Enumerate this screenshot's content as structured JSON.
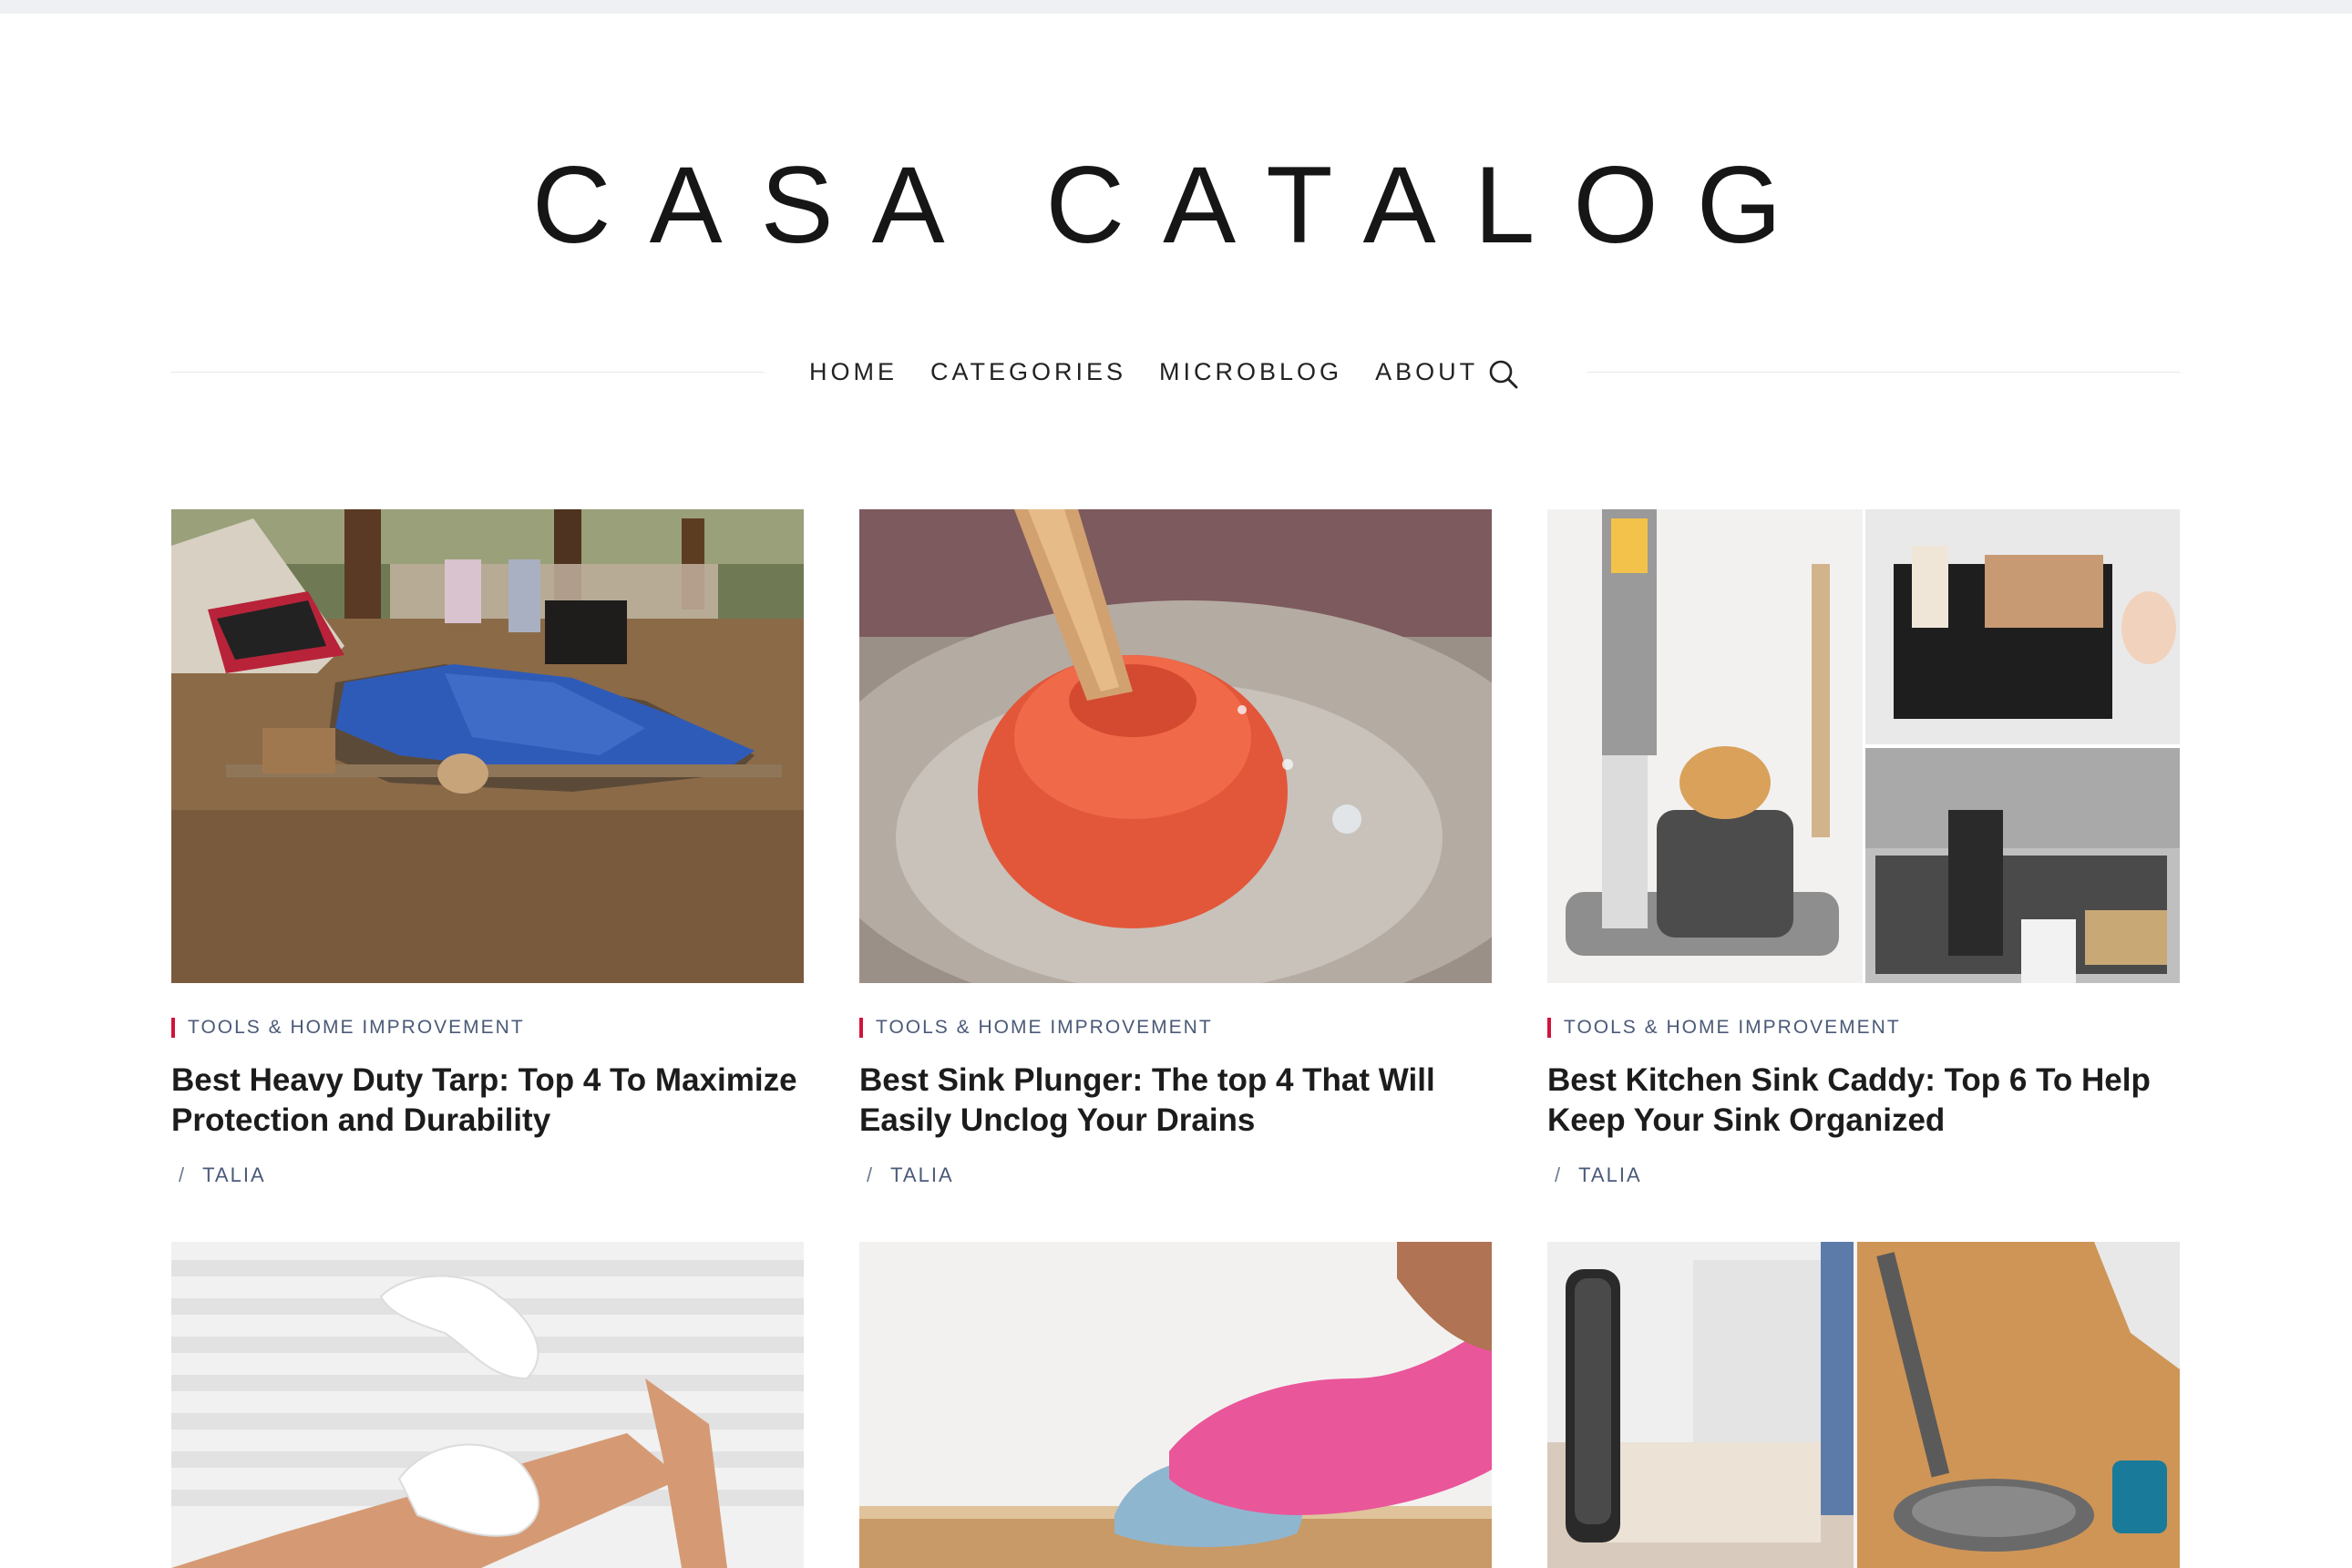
{
  "site": {
    "logo_text": "CASA CATALOG"
  },
  "nav": {
    "items": [
      "HOME",
      "CATEGORIES",
      "MICROBLOG",
      "ABOUT"
    ],
    "search_icon": "search-icon"
  },
  "colors": {
    "accent": "#d2143a",
    "meta": "#4a5a78",
    "divider": "#e6e6e6"
  },
  "posts": [
    {
      "category": "TOOLS & HOME IMPROVEMENT",
      "title": "Best Heavy Duty Tarp: Top 4 To Maximize Protection and Durability",
      "author_sep": "/",
      "author": "TALIA",
      "image": "campsite-tarp-photo"
    },
    {
      "category": "TOOLS & HOME IMPROVEMENT",
      "title": "Best Sink Plunger: The top 4 That Will Easily Unclog Your Drains",
      "author_sep": "/",
      "author": "TALIA",
      "image": "sink-plunger-photo"
    },
    {
      "category": "TOOLS & HOME IMPROVEMENT",
      "title": "Best Kitchen Sink Caddy: Top 6 To Help Keep Your Sink Organized",
      "author_sep": "/",
      "author": "TALIA",
      "image": "sink-caddy-collage-photo"
    },
    {
      "image": "white-gloves-photo"
    },
    {
      "image": "pink-glove-cleaning-photo"
    },
    {
      "image": "floor-mop-collage-photo"
    }
  ]
}
